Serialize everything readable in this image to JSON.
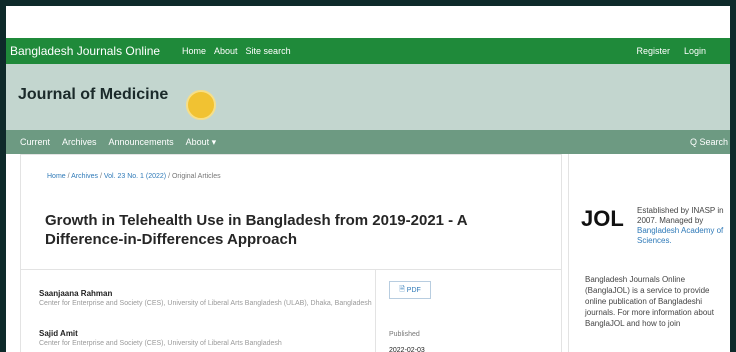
{
  "topbar": {
    "site_name": "Bangladesh Journals Online",
    "nav": [
      "Home",
      "About",
      "Site search"
    ],
    "register": "Register",
    "login": "Login"
  },
  "header": {
    "journal_title": "Journal of Medicine"
  },
  "subnav": {
    "items": [
      "Current",
      "Archives",
      "Announcements",
      "About ▾"
    ],
    "search": "Q Search"
  },
  "breadcrumb": {
    "items": [
      "Home",
      "Archives",
      "Vol. 23 No. 1 (2022)",
      "Original Articles"
    ],
    "separator": "/"
  },
  "article": {
    "title": "Growth in Telehealth Use in Bangladesh from 2019-2021 - A Difference-in-Differences Approach",
    "authors": [
      {
        "name": "Saanjaana Rahman",
        "affiliation": "Center for Enterprise and Society (CES), University of Liberal Arts Bangladesh (ULAB), Dhaka, Bangladesh"
      },
      {
        "name": "Sajid Amit",
        "affiliation": "Center for Enterprise and Society (CES), University of Liberal Arts Bangladesh"
      }
    ],
    "pdf_label": "PDF",
    "published_label": "Published",
    "published_date": "2022-02-03"
  },
  "sidebar": {
    "jol_logo": "JOL",
    "jol_text_before": "Established by INASP in 2007. Managed by",
    "jol_link": "Bangladesh Academy of Sciences.",
    "description": "Bangladesh Journals Online (BanglaJOL) is a service to provide online publication of Bangladeshi journals. For more information about BanglaJOL and how to join"
  }
}
